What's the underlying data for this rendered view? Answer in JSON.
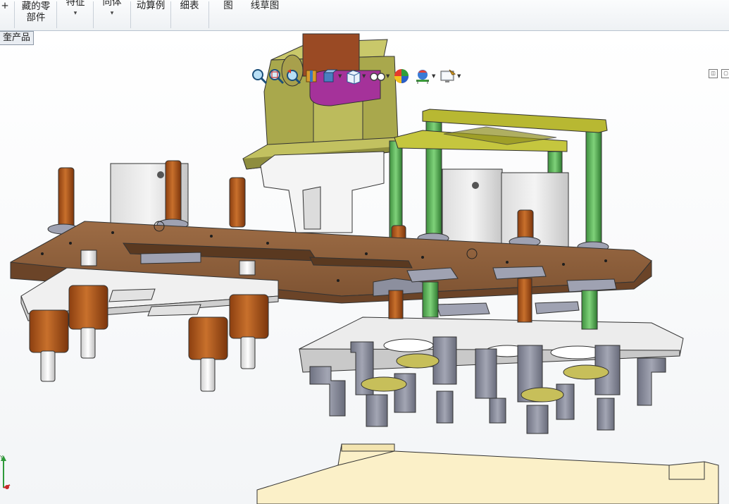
{
  "ribbon": {
    "items": [
      {
        "label": "+",
        "has_arrow": false
      },
      {
        "label": "藏的零\n部件",
        "has_arrow": false
      },
      {
        "label": "特征",
        "has_arrow": true
      },
      {
        "label": "同体",
        "has_arrow": true
      },
      {
        "label": "动算例",
        "has_arrow": false
      },
      {
        "label": "细表",
        "has_arrow": false
      },
      {
        "label": "图",
        "has_arrow": false
      },
      {
        "label": "线草图",
        "has_arrow": false
      }
    ]
  },
  "assembly_tab": {
    "label": "奎产品"
  },
  "hud_icons": [
    "zoom-to-fit-icon",
    "zoom-area-icon",
    "previous-view-icon",
    "section-view-icon",
    "view-orientation-icon",
    "display-style-icon",
    "hide-show-items-icon",
    "edit-appearance-icon",
    "apply-scene-icon",
    "view-settings-icon"
  ],
  "colors": {
    "brown_plate": "#8a5d3b",
    "white_plate": "#f0f0f0",
    "olive_frame": "#a9a84c",
    "green_rod": "#5cb85c",
    "copper": "#b25a1e",
    "steel_gray": "#8c8f9e",
    "cream_base": "#fbf0c8",
    "purple": "#a5329a"
  }
}
